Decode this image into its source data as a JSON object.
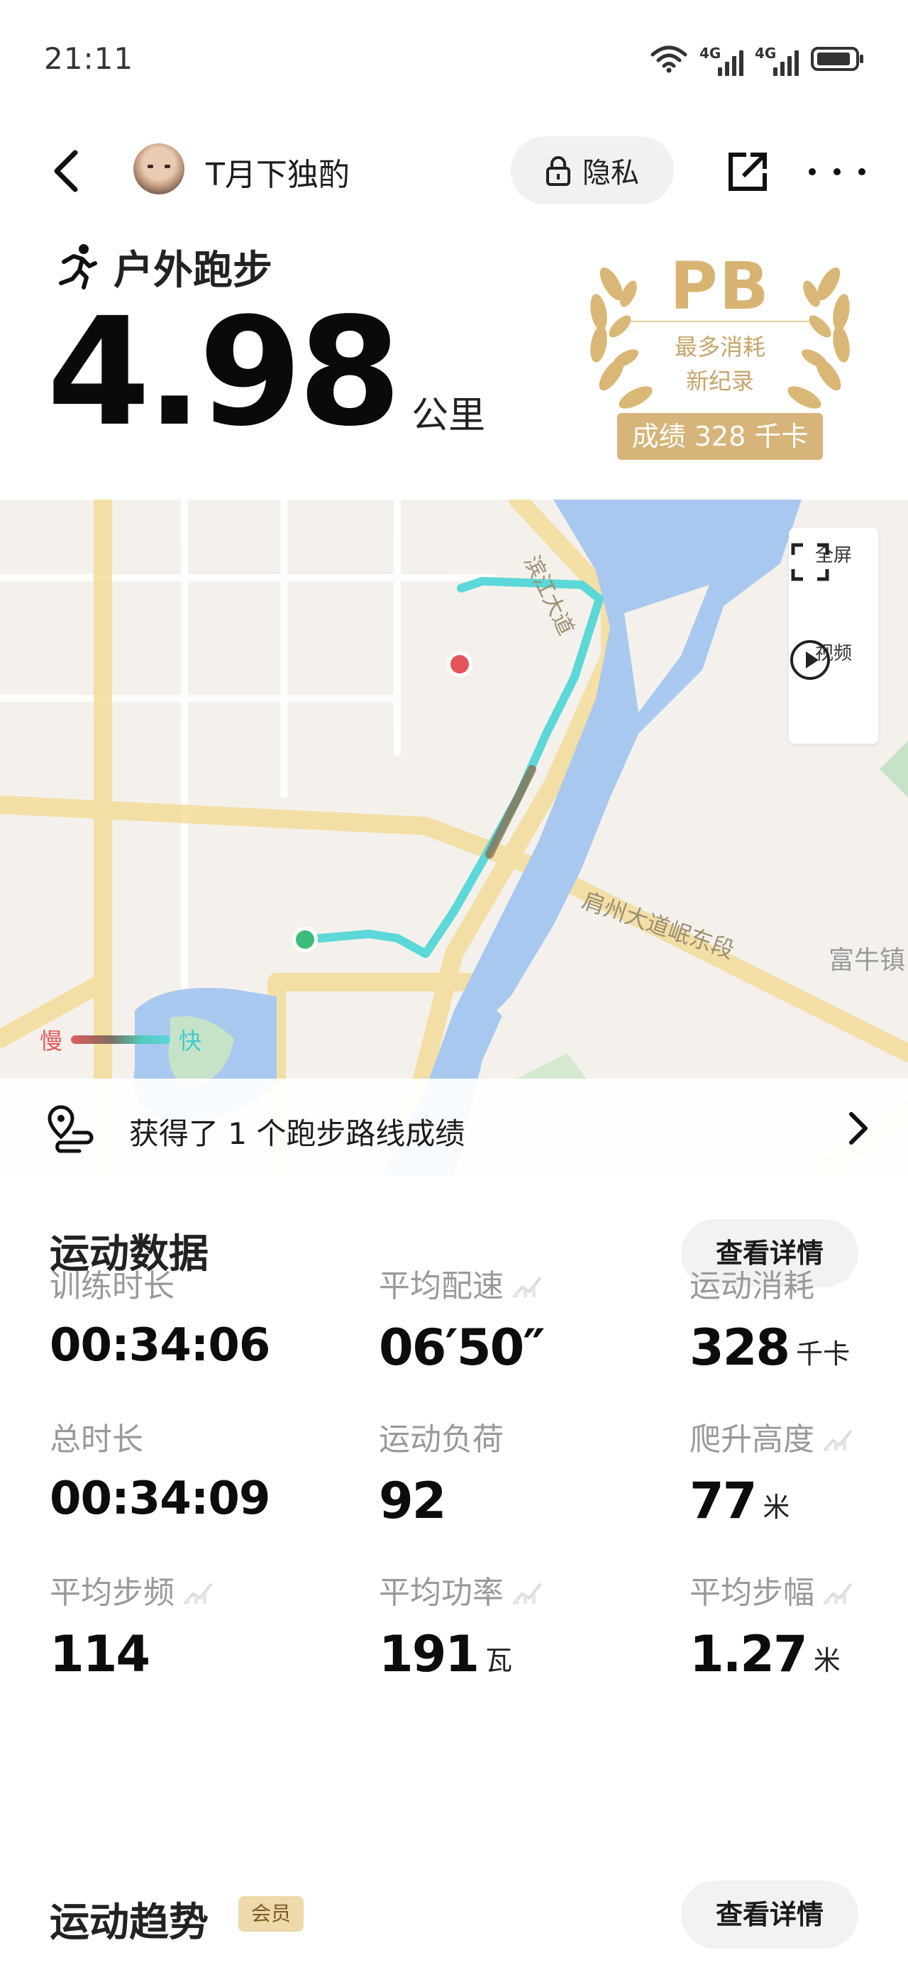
{
  "status_bar": {
    "time": "21:11",
    "signal_label_1": "4G",
    "signal_label_2": "4G"
  },
  "header": {
    "username": "T月下独酌",
    "privacy_label": "隐私"
  },
  "activity": {
    "type_label": "户外跑步",
    "distance": "4.98",
    "distance_unit": "公里"
  },
  "pb_badge": {
    "title": "PB",
    "line1": "最多消耗",
    "line2": "新纪录",
    "result": "成绩 328 千卡"
  },
  "map": {
    "road_label_1": "滨江大道",
    "road_label_2": "肩州大道岷东段",
    "place_label": "富牛镇",
    "fullscreen_label": "全屏",
    "video_label": "视频",
    "speed_slow_label": "慢",
    "speed_fast_label": "快",
    "colors": {
      "water": "#a9c8f0",
      "road": "#f7e4a8",
      "route_fast": "#52d6d6",
      "route_slow": "#8a6a4a",
      "start_point": "#3dbb7a",
      "end_point": "#e4545a"
    }
  },
  "route_achievement": {
    "text": "获得了 1 个跑步路线成绩"
  },
  "sports_data": {
    "title": "运动数据",
    "detail_label": "查看详情",
    "stats": [
      {
        "label": "训练时长",
        "value": "00:34:06",
        "unit": "",
        "trend": false
      },
      {
        "label": "平均配速",
        "value": "06′50″",
        "unit": "",
        "trend": true
      },
      {
        "label": "运动消耗",
        "value": "328",
        "unit": "千卡",
        "trend": false
      },
      {
        "label": "总时长",
        "value": "00:34:09",
        "unit": "",
        "trend": false
      },
      {
        "label": "运动负荷",
        "value": "92",
        "unit": "",
        "trend": false
      },
      {
        "label": "爬升高度",
        "value": "77",
        "unit": "米",
        "trend": true
      },
      {
        "label": "平均步频",
        "value": "114",
        "unit": "",
        "trend": true
      },
      {
        "label": "平均功率",
        "value": "191",
        "unit": "瓦",
        "trend": true
      },
      {
        "label": "平均步幅",
        "value": "1.27",
        "unit": "米",
        "trend": true
      }
    ]
  },
  "trend": {
    "title": "运动趋势",
    "member_badge": "会员",
    "detail_label": "查看详情"
  },
  "icons": [
    "back-arrow-icon",
    "lock-icon",
    "share-icon",
    "more-icon",
    "running-icon",
    "fullscreen-icon",
    "play-icon",
    "route-pin-icon",
    "chevron-right-icon",
    "trend-icon",
    "wifi-icon",
    "battery-icon"
  ]
}
